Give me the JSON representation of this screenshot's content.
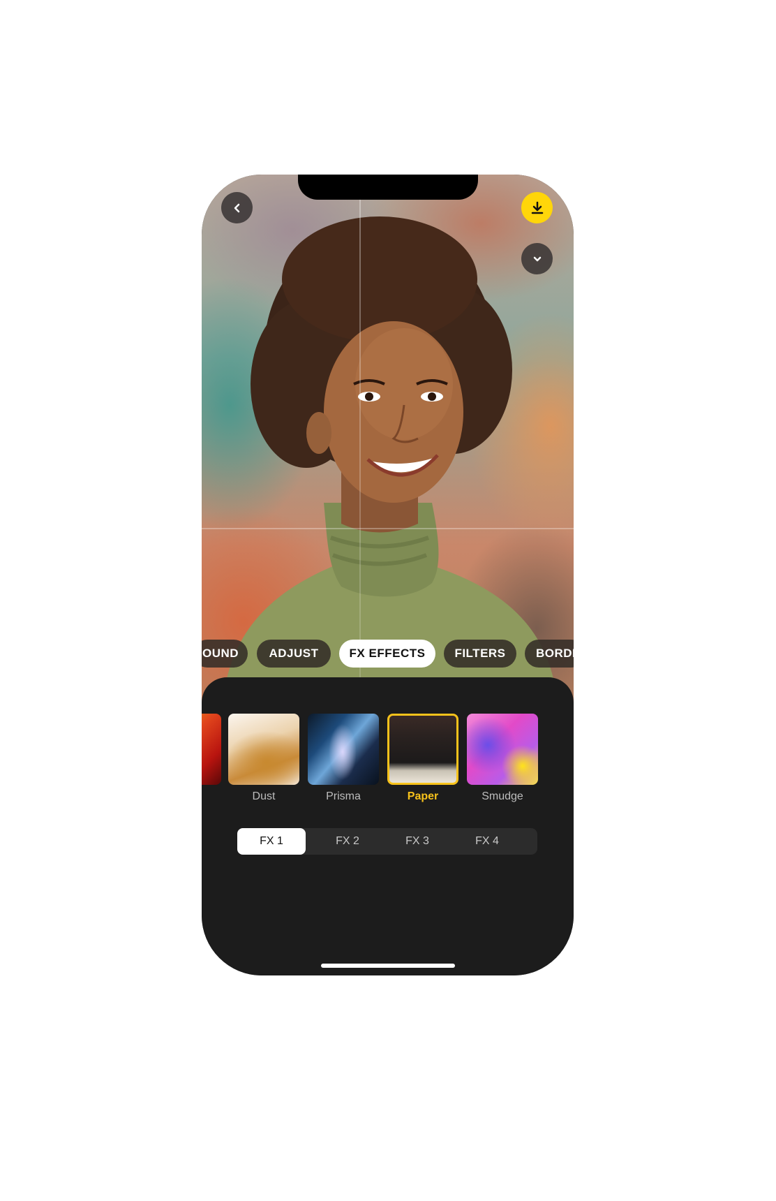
{
  "tabs": [
    {
      "label": "OUND",
      "active": false
    },
    {
      "label": "ADJUST",
      "active": false
    },
    {
      "label": "FX EFFECTS",
      "active": true
    },
    {
      "label": "FILTERS",
      "active": false
    },
    {
      "label": "BORDI",
      "active": false
    }
  ],
  "effects": [
    {
      "label": "",
      "selected": false
    },
    {
      "label": "Dust",
      "selected": false
    },
    {
      "label": "Prisma",
      "selected": false
    },
    {
      "label": "Paper",
      "selected": true
    },
    {
      "label": "Smudge",
      "selected": false
    }
  ],
  "variants": [
    {
      "label": "FX 1",
      "active": true
    },
    {
      "label": "FX 2",
      "active": false
    },
    {
      "label": "FX 3",
      "active": false
    },
    {
      "label": "FX 4",
      "active": false
    }
  ],
  "colors": {
    "accent": "#ffd60a",
    "selected_label": "#f7c21b",
    "panel": "#1c1c1c"
  },
  "icons": {
    "back": "chevron-left-icon",
    "download": "download-icon",
    "collapse": "chevron-down-icon"
  }
}
